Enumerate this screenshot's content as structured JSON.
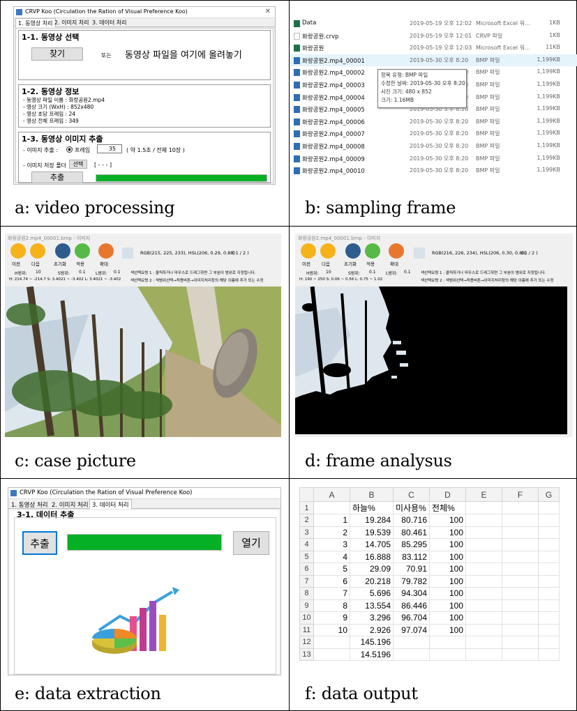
{
  "captions": {
    "a": "a: video processing",
    "b": "b: sampling frame",
    "c": "c: case picture",
    "d": "d: frame analysus",
    "e": "e: data extraction",
    "f": "f: data output"
  },
  "panel_a": {
    "window_title": "CRVP Koo (Circulation the Ration of Visual Preference Koo)",
    "tabs": [
      "1. 동영상 처리",
      "2. 이미지 처리",
      "3. 데이터 처리"
    ],
    "section1_title": "1-1. 동영상 선택",
    "find_button": "찾기",
    "or_label": "또는",
    "drop_hint": "동영상 파일을 여기에 올려놓기",
    "section2_title": "1-2. 동영상 정보",
    "info_lines": [
      "- 동영상 파일 이름 :   화랑공원2.mp4",
      "- 영상 크기 (WxH) :   852x480",
      "- 영상 초당 프레임 :   24",
      "- 영상 전체 프레임 :   349"
    ],
    "section3_title": "1-3. 동영상 이미지 추출",
    "extract_label": "- 이미지 추출 :",
    "frame_radio": "프레임",
    "frame_value": "35",
    "frame_note": "( 약 1.5초 / 전체 10장 )",
    "folder_label": "- 이미지 저장 폴더",
    "select_button": "선택",
    "folder_value": "[ - - - ]",
    "extract_button": "추출",
    "progress": 1.0
  },
  "panel_b": {
    "files": [
      {
        "name": "Data",
        "date": "2019-05-19 오후 12:02",
        "type": "Microsoft Excel 워...",
        "size": "1KB",
        "icon": "excel-icon"
      },
      {
        "name": "화랑공원.crvp",
        "date": "2019-05-19 오후 12:01",
        "type": "CRVP 파일",
        "size": "1KB",
        "icon": "file-icon"
      },
      {
        "name": "화랑공원",
        "date": "2019-05-19 오후 12:03",
        "type": "Microsoft Excel 워...",
        "size": "11KB",
        "icon": "excel-icon"
      },
      {
        "name": "화랑공원2.mp4_00001",
        "date": "2019-05-30 오후 8:20",
        "type": "BMP 파일",
        "size": "1,199KB",
        "icon": "bmp-icon"
      },
      {
        "name": "화랑공원2.mp4_00002",
        "date": "2019-05-30 오후 8:20",
        "type": "BMP 파일",
        "size": "1,199KB",
        "icon": "bmp-icon"
      },
      {
        "name": "화랑공원2.mp4_00003",
        "date": "2019-05-30 오후 8:20",
        "type": "BMP 파일",
        "size": "1,199KB",
        "icon": "bmp-icon"
      },
      {
        "name": "화랑공원2.mp4_00004",
        "date": "2019-05-30 오후 8:20",
        "type": "BMP 파일",
        "size": "1,199KB",
        "icon": "bmp-icon"
      },
      {
        "name": "화랑공원2.mp4_00005",
        "date": "2019-05-30 오후 8:20",
        "type": "BMP 파일",
        "size": "1,199KB",
        "icon": "bmp-icon"
      },
      {
        "name": "화랑공원2.mp4_00006",
        "date": "2019-05-30 오후 8:20",
        "type": "BMP 파일",
        "size": "1,199KB",
        "icon": "bmp-icon"
      },
      {
        "name": "화랑공원2.mp4_00007",
        "date": "2019-05-30 오후 8:20",
        "type": "BMP 파일",
        "size": "1,199KB",
        "icon": "bmp-icon"
      },
      {
        "name": "화랑공원2.mp4_00008",
        "date": "2019-05-30 오후 8:20",
        "type": "BMP 파일",
        "size": "1,199KB",
        "icon": "bmp-icon"
      },
      {
        "name": "화랑공원2.mp4_00009",
        "date": "2019-05-30 오후 8:20",
        "type": "BMP 파일",
        "size": "1,199KB",
        "icon": "bmp-icon"
      },
      {
        "name": "화랑공원2.mp4_00010",
        "date": "2019-05-30 오후 8:20",
        "type": "BMP 파일",
        "size": "1,199KB",
        "icon": "bmp-icon"
      }
    ],
    "tooltip": [
      "항목 유형: BMP 파일",
      "수정한 날짜: 2019-05-30 오후 8:20",
      "사진 크기: 480 x 852",
      "크기: 1.16MB"
    ]
  },
  "panel_c": {
    "title": "화랑공원2.mp4_00001.bmp - 이미지",
    "toolbar": [
      "이전",
      "다음",
      "초기화",
      "적용",
      "확대"
    ],
    "rgb_text": "RGB(215, 225, 233), HSL(206, 0.29, 0.88)",
    "page": "( 1 / 2 )",
    "range_row": [
      "H범위:",
      "10",
      "S범위:",
      "0.1",
      "L범위:",
      "0.1"
    ],
    "guide1": "색선택요령 1 : 클릭하거나 마우스로 드래그하면 그 부분이 범위로 지정됩니다.",
    "guide2": "색선택요령 2 : 색범위선택→적용버튼→이미지처리창의 해당 이름에 추가 또는 수정",
    "hsl_row": "H: 214.74 ~ -214.7   S: 3.4021 ~ -3.402   L: 3.4021 ~ -3.402"
  },
  "panel_d": {
    "title": "화랑공원2.mp4_00001.bmp - 이미지",
    "toolbar": [
      "이전",
      "다음",
      "초기화",
      "적용",
      "확대"
    ],
    "rgb_text": "RGB(216, 226, 234), HSL(206, 0.30, 0.88)",
    "page": "( 1 / 2 )",
    "range_row": [
      "H범위:",
      "10",
      "S범위:",
      "0.1",
      "L범위:",
      "0.1"
    ],
    "guide1": "색선택요령 1 : 클릭하거나 마우스로 드래그하면 그 부분이 범위로 지정됩니다.",
    "guide2": "색선택요령 2 : 색범위선택→적용버튼→이미지처리창의 해당 이름에 추가 또는 수정",
    "hsl_row": "H: 190 ~ 250   S: 0.06 ~ 0.56   L: 0.75 ~ 1.02"
  },
  "panel_e": {
    "window_title": "CRVP Koo (Circulation the Ration of Visual Preference Koo)",
    "tabs": [
      "1. 동영상 처리",
      "2. 이미지 처리",
      "3. 데이터 처리"
    ],
    "section_title": "3-1. 데이터 추출",
    "extract_button": "추출",
    "open_button": "열기",
    "progress": 1.0
  },
  "panel_f": {
    "columns": [
      "A",
      "B",
      "C",
      "D",
      "E",
      "F",
      "G"
    ],
    "headers": [
      "",
      "하늘%",
      "미사용%",
      "전체%"
    ],
    "rows": [
      [
        "1",
        "19.284",
        "80.716",
        "100"
      ],
      [
        "2",
        "19.539",
        "80.461",
        "100"
      ],
      [
        "3",
        "14.705",
        "85.295",
        "100"
      ],
      [
        "4",
        "16.888",
        "83.112",
        "100"
      ],
      [
        "5",
        "29.09",
        "70.91",
        "100"
      ],
      [
        "6",
        "20.218",
        "79.782",
        "100"
      ],
      [
        "7",
        "5.696",
        "94.304",
        "100"
      ],
      [
        "8",
        "13.554",
        "86.446",
        "100"
      ],
      [
        "9",
        "3.296",
        "96.704",
        "100"
      ],
      [
        "10",
        "2.926",
        "97.074",
        "100"
      ],
      [
        "",
        "145.196",
        "",
        ""
      ],
      [
        "",
        "14.5196",
        "",
        ""
      ]
    ]
  }
}
